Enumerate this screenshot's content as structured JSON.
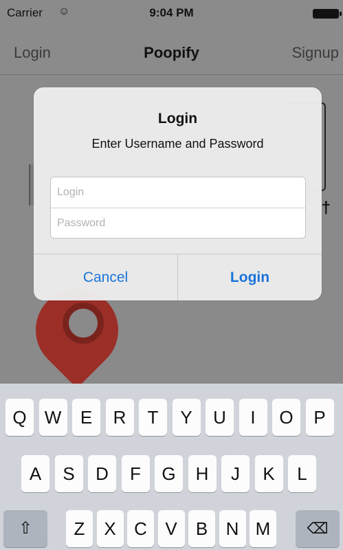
{
  "status_bar": {
    "carrier": "Carrier",
    "wifi_icon": "wifi-icon",
    "time": "9:04 PM",
    "battery_icon": "battery-icon"
  },
  "nav_bar": {
    "left_button": "Login",
    "title": "Poopify",
    "right_button": "Signup"
  },
  "background": {
    "dagger_mark": "†",
    "pin_icon": "map-pin-icon"
  },
  "alert": {
    "title": "Login",
    "message": "Enter Username and Password",
    "login_placeholder": "Login",
    "password_placeholder": "Password",
    "cancel_label": "Cancel",
    "login_label": "Login",
    "button_color": "#1a73d9"
  },
  "keyboard": {
    "row1": [
      "Q",
      "W",
      "E",
      "R",
      "T",
      "Y",
      "U",
      "I",
      "O",
      "P"
    ],
    "row2": [
      "A",
      "S",
      "D",
      "F",
      "G",
      "H",
      "J",
      "K",
      "L"
    ],
    "row3": [
      "Z",
      "X",
      "C",
      "V",
      "B",
      "N",
      "M"
    ],
    "shift_icon": "shift-icon",
    "delete_icon": "delete-icon"
  },
  "colors": {
    "accent": "#1a73d9",
    "pin": "#9b2f27",
    "keyboard_background": "#d0d4da"
  }
}
